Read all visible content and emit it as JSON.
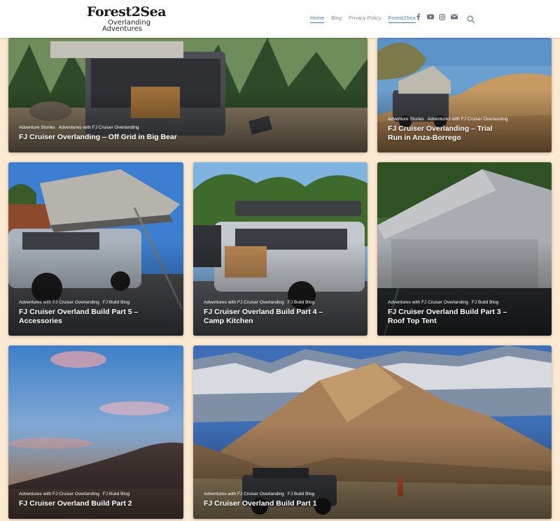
{
  "site": {
    "logo_main": "Forest2Sea",
    "logo_sub1": "Overlanding",
    "logo_sub2": "Adventures"
  },
  "nav": [
    "Home",
    "Blog",
    "Privacy Policy",
    "Forest2Sea"
  ],
  "social_icons": [
    "facebook-icon",
    "youtube-icon",
    "instagram-icon",
    "email-icon"
  ],
  "posts": [
    {
      "cats": [
        "Adventure Stories",
        "Adventures with FJ Cruiser Overlanding"
      ],
      "title": "FJ Cruiser Overlanding – Off Grid in Big Bear"
    },
    {
      "cats": [
        "Adventure Stories",
        "Adventures with FJ Cruiser Overlanding"
      ],
      "title": "FJ Cruiser Overlanding – Trial Run in Anza-Borrego"
    },
    {
      "cats": [
        "Adventures with FJ Cruiser Overlanding",
        "FJ Build Blog"
      ],
      "title": "FJ Cruiser Overland Build Part 5 – Accessories"
    },
    {
      "cats": [
        "Adventures with FJ Cruiser Overlanding",
        "FJ Build Blog"
      ],
      "title": "FJ Cruiser Overland Build Part 4 – Camp Kitchen"
    },
    {
      "cats": [
        "Adventures with FJ Cruiser Overlanding",
        "FJ Build Blog"
      ],
      "title": "FJ Cruiser Overland Build Part 3 – Roof Top Tent"
    },
    {
      "cats": [
        "Adventures with FJ Cruiser Overlanding",
        "FJ Build Blog"
      ],
      "title": "FJ Cruiser Overland Build Part 2"
    },
    {
      "cats": [
        "Adventures with FJ Cruiser Overlanding",
        "FJ Build Blog"
      ],
      "title": "FJ Cruiser Overland Build Part 1"
    }
  ]
}
